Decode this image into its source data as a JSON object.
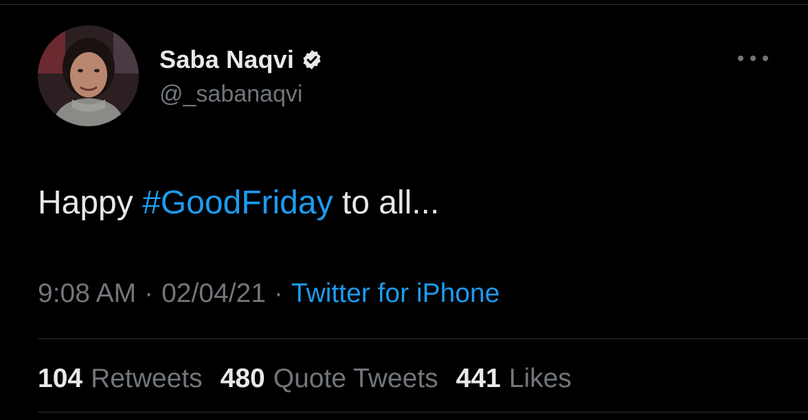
{
  "author": {
    "display_name": "Saba Naqvi",
    "handle": "@_sabanaqvi",
    "verified": true
  },
  "icons": {
    "verified": "verified-badge-icon",
    "more": "more-options-icon"
  },
  "tweet": {
    "text_before": "Happy ",
    "hashtag": "#GoodFriday",
    "text_after": " to all..."
  },
  "meta": {
    "time": "9:08 AM",
    "date": "02/04/21",
    "separator": "·",
    "source": "Twitter for iPhone"
  },
  "stats": {
    "retweets_count": "104",
    "retweets_label": "Retweets",
    "quotes_count": "480",
    "quotes_label": "Quote Tweets",
    "likes_count": "441",
    "likes_label": "Likes"
  },
  "colors": {
    "background": "#000000",
    "primary_text": "#e7e9ea",
    "secondary_text": "#71767b",
    "accent": "#1d9bf0"
  }
}
